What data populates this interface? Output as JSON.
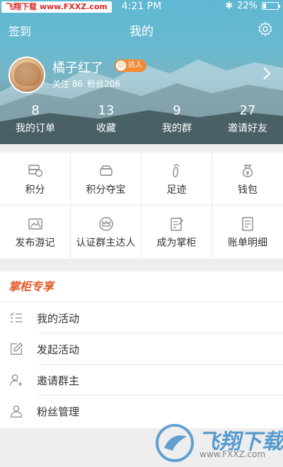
{
  "status_bar": {
    "carrier": "飞翔下载 www.FXXZ.com",
    "time": "4:21 PM",
    "bluetooth": "✱",
    "battery_label": "22%",
    "battery_level": 0.22
  },
  "nav": {
    "left_label": "签到",
    "title": "我的",
    "right_icon": "settings-gear"
  },
  "profile": {
    "name": "橘子红了",
    "badge": "达人",
    "following": "关注 86",
    "followers": "粉丝206"
  },
  "stats": [
    {
      "value": "8",
      "label": "我的订单"
    },
    {
      "value": "13",
      "label": "收藏"
    },
    {
      "value": "9",
      "label": "我的群"
    },
    {
      "value": "27",
      "label": "邀请好友"
    }
  ],
  "grid": [
    {
      "label": "积分",
      "icon": "points-icon"
    },
    {
      "label": "积分夺宝",
      "icon": "treasure-icon"
    },
    {
      "label": "足迹",
      "icon": "footprint-icon"
    },
    {
      "label": "钱包",
      "icon": "wallet-icon"
    },
    {
      "label": "发布游记",
      "icon": "image-icon"
    },
    {
      "label": "认证群主达人",
      "icon": "crown-icon"
    },
    {
      "label": "成为掌柜",
      "icon": "edit-note-icon"
    },
    {
      "label": "账单明细",
      "icon": "bill-icon"
    }
  ],
  "section": {
    "title": "掌柜专享",
    "items": [
      {
        "label": "我的活动",
        "icon": "list-icon"
      },
      {
        "label": "发起活动",
        "icon": "edit-icon"
      },
      {
        "label": "邀请群主",
        "icon": "add-user-icon"
      },
      {
        "label": "粉丝管理",
        "icon": "user-icon"
      }
    ]
  },
  "watermark": {
    "text": "飞翔下载",
    "url": "www.FXXZ.com"
  },
  "colors": {
    "accent": "#e25b2b",
    "badge": "#f08c38",
    "icon": "#8a8a8a"
  }
}
